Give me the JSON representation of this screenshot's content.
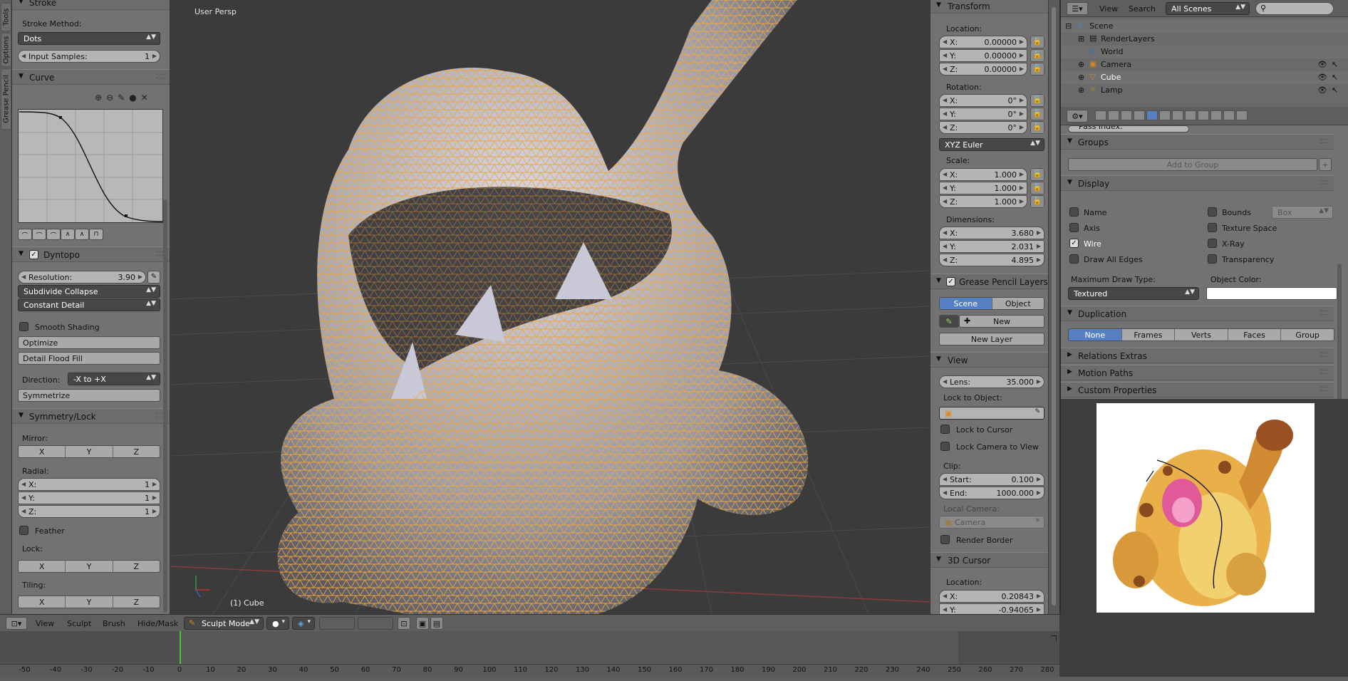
{
  "tabs": [
    "Tools",
    "Options",
    "Grease Pencil"
  ],
  "left_panel": {
    "stroke_header": "Stroke",
    "stroke_method_label": "Stroke Method:",
    "stroke_method_value": "Dots",
    "input_samples_label": "Input Samples:",
    "input_samples_value": "1",
    "curve_header": "Curve",
    "dyntopo_header": "Dyntopo",
    "resolution_label": "Resolution:",
    "resolution_value": "3.90",
    "subdivide_value": "Subdivide Collapse",
    "detail_value": "Constant Detail",
    "smooth_shading": "Smooth Shading",
    "optimize": "Optimize",
    "detail_flood_fill": "Detail Flood Fill",
    "direction_label": "Direction:",
    "direction_value": "-X to +X",
    "symmetrize": "Symmetrize",
    "symmetry_header": "Symmetry/Lock",
    "mirror_label": "Mirror:",
    "axes": [
      "X",
      "Y",
      "Z"
    ],
    "radial_label": "Radial:",
    "radial": [
      {
        "k": "X:",
        "v": "1"
      },
      {
        "k": "Y:",
        "v": "1"
      },
      {
        "k": "Z:",
        "v": "1"
      }
    ],
    "feather": "Feather",
    "lock_label": "Lock:",
    "tiling_label": "Tiling:"
  },
  "viewport": {
    "view_label": "User Persp",
    "object_label": "(1) Cube"
  },
  "npanel": {
    "transform_header": "Transform",
    "location_label": "Location:",
    "location": [
      {
        "k": "X:",
        "v": "0.00000"
      },
      {
        "k": "Y:",
        "v": "0.00000"
      },
      {
        "k": "Z:",
        "v": "0.00000"
      }
    ],
    "rotation_label": "Rotation:",
    "rotation": [
      {
        "k": "X:",
        "v": "0°"
      },
      {
        "k": "Y:",
        "v": "0°"
      },
      {
        "k": "Z:",
        "v": "0°"
      }
    ],
    "rotation_mode": "XYZ Euler",
    "scale_label": "Scale:",
    "scale": [
      {
        "k": "X:",
        "v": "1.000"
      },
      {
        "k": "Y:",
        "v": "1.000"
      },
      {
        "k": "Z:",
        "v": "1.000"
      }
    ],
    "dimensions_label": "Dimensions:",
    "dimensions": [
      {
        "k": "X:",
        "v": "3.680"
      },
      {
        "k": "Y:",
        "v": "2.031"
      },
      {
        "k": "Z:",
        "v": "4.895"
      }
    ],
    "gp_header": "Grease Pencil Layers",
    "gp_scene": "Scene",
    "gp_object": "Object",
    "gp_new": "New",
    "gp_new_layer": "New Layer",
    "view_header": "View",
    "lens_label": "Lens:",
    "lens_value": "35.000",
    "lock_to_object": "Lock to Object:",
    "lock_to_cursor": "Lock to Cursor",
    "lock_camera": "Lock Camera to View",
    "clip_label": "Clip:",
    "clip_start_k": "Start:",
    "clip_start_v": "0.100",
    "clip_end_k": "End:",
    "clip_end_v": "1000.000",
    "local_camera": "Local Camera:",
    "camera_value": "Camera",
    "render_border": "Render Border",
    "cursor_header": "3D Cursor",
    "cursor_location_label": "Location:",
    "cursor": [
      {
        "k": "X:",
        "v": "0.20843"
      },
      {
        "k": "Y:",
        "v": "-0.94065"
      }
    ]
  },
  "outliner": {
    "view": "View",
    "search": "Search",
    "scenes": "All Scenes",
    "items": [
      "Scene",
      "RenderLayers",
      "World",
      "Camera",
      "Cube",
      "Lamp"
    ]
  },
  "properties": {
    "pass_index": "Pass Index:",
    "groups_header": "Groups",
    "add_to_group": "Add to Group",
    "display_header": "Display",
    "name": "Name",
    "axis": "Axis",
    "wire": "Wire",
    "draw_all_edges": "Draw All Edges",
    "bounds": "Bounds",
    "bounds_value": "Box",
    "texture_space": "Texture Space",
    "xray": "X-Ray",
    "transparency": "Transparency",
    "max_draw_type_label": "Maximum Draw Type:",
    "max_draw_type": "Textured",
    "object_color_label": "Object Color:",
    "duplication_header": "Duplication",
    "dup_modes": [
      "None",
      "Frames",
      "Verts",
      "Faces",
      "Group"
    ],
    "relations_extras": "Relations Extras",
    "motion_paths": "Motion Paths",
    "custom_properties": "Custom Properties"
  },
  "header": {
    "menus": [
      "View",
      "Sculpt",
      "Brush",
      "Hide/Mask"
    ],
    "mode": "Sculpt Mode"
  },
  "timeline": {
    "current_frame": 0,
    "ticks": [
      "-50",
      "-40",
      "-30",
      "-20",
      "-10",
      "0",
      "10",
      "20",
      "30",
      "40",
      "50",
      "60",
      "70",
      "80",
      "90",
      "100",
      "110",
      "120",
      "130",
      "140",
      "150",
      "160",
      "170",
      "180",
      "190",
      "200",
      "210",
      "220",
      "230",
      "240",
      "250",
      "260",
      "270",
      "280"
    ]
  }
}
